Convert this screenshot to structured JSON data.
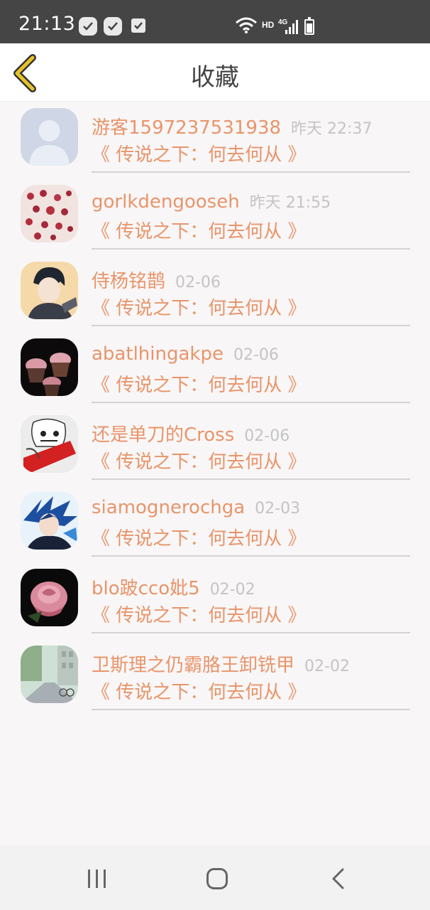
{
  "status_bar": {
    "time": "21:13",
    "network_hd": "HD",
    "network_type": "4G",
    "icons": [
      "notification-app-icon",
      "notification-app-icon",
      "checkbox-notification-icon",
      "wifi-icon",
      "signal-icon",
      "battery-icon"
    ]
  },
  "header": {
    "title": "收藏",
    "back_icon": "chevron-left-icon",
    "accent_color": "#e6c229"
  },
  "favorites": [
    {
      "username": "游客1597237531938",
      "time": "昨天 22:37",
      "title": "《 传说之下：何去何从 》",
      "avatar": "default-user-avatar"
    },
    {
      "username": "gorlkdengooseh",
      "time": "昨天 21:55",
      "title": "《 传说之下：何去何从 》",
      "avatar": "cherry-blossom-avatar"
    },
    {
      "username": "侍杨铭鹊",
      "time": "02-06",
      "title": "《 传说之下：何去何从 》",
      "avatar": "anime-boy-avatar"
    },
    {
      "username": "abatlhingakpe",
      "time": "02-06",
      "title": "《 传说之下：何去何从 》",
      "avatar": "cupcakes-avatar"
    },
    {
      "username": "还是单刀的Cross",
      "time": "02-06",
      "title": "《 传说之下：何去何从 》",
      "avatar": "sketch-character-avatar"
    },
    {
      "username": "siamognerochga",
      "time": "02-03",
      "title": "《 传说之下：何去何从 》",
      "avatar": "blue-hair-anime-avatar"
    },
    {
      "username": "blo跛cco妣5",
      "time": "02-02",
      "title": "《 传说之下：何去何从 》",
      "avatar": "rose-avatar"
    },
    {
      "username": "卫斯理之仍霸胳王卸铣甲",
      "time": "02-02",
      "title": "《 传说之下：何去何从 》",
      "avatar": "street-scene-avatar"
    }
  ],
  "colors": {
    "username": "#e8956a",
    "time": "#c4c4c4",
    "background": "#f8f6f7"
  },
  "nav_bar": {
    "icons": [
      "recent-apps-icon",
      "home-icon",
      "back-icon"
    ]
  }
}
